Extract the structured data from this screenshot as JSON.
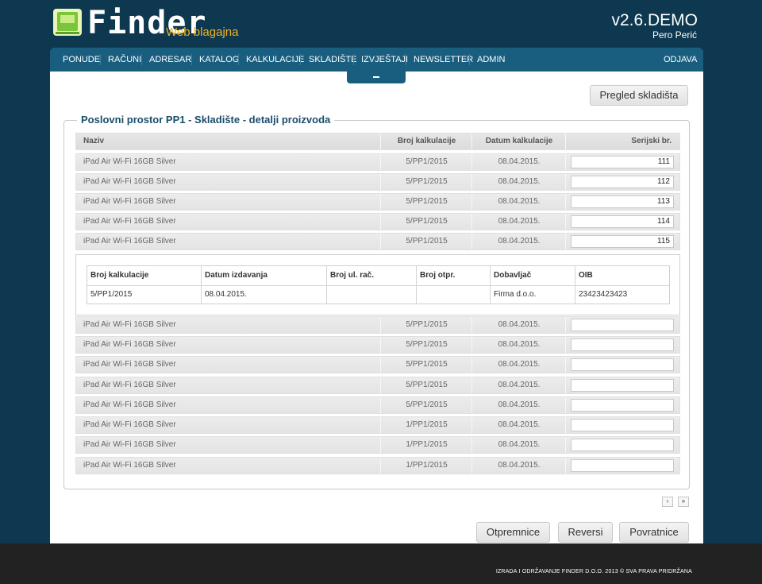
{
  "header": {
    "logo_text": "Finder",
    "logo_sub": "Web blagajna",
    "version": "v2.6.DEMO",
    "user": "Pero Perić"
  },
  "nav": {
    "items": [
      "PONUDE",
      "RAČUNI",
      "ADRESAR",
      "KATALOG",
      "KALKULACIJE",
      "SKLADIŠTE",
      "IZVJEŠTAJI",
      "NEWSLETTER",
      "ADMIN"
    ],
    "logout": "ODJAVA"
  },
  "toolbar": {
    "overview_button": "Pregled skladišta"
  },
  "panel": {
    "legend": "Poslovni prostor PP1 - Skladište - detalji proizvoda"
  },
  "table": {
    "columns": [
      "Naziv",
      "Broj kalkulacije",
      "Datum kalkulacije",
      "Serijski br."
    ],
    "rows": [
      {
        "name": "iPad Air Wi-Fi 16GB Silver",
        "broj": "5/PP1/2015",
        "datum": "08.04.2015.",
        "serial": "111"
      },
      {
        "name": "iPad Air Wi-Fi 16GB Silver",
        "broj": "5/PP1/2015",
        "datum": "08.04.2015.",
        "serial": "112"
      },
      {
        "name": "iPad Air Wi-Fi 16GB Silver",
        "broj": "5/PP1/2015",
        "datum": "08.04.2015.",
        "serial": "113"
      },
      {
        "name": "iPad Air Wi-Fi 16GB Silver",
        "broj": "5/PP1/2015",
        "datum": "08.04.2015.",
        "serial": "114"
      },
      {
        "name": "iPad Air Wi-Fi 16GB Silver",
        "broj": "5/PP1/2015",
        "datum": "08.04.2015.",
        "serial": "115"
      },
      {
        "name": "iPad Air Wi-Fi 16GB Silver",
        "broj": "5/PP1/2015",
        "datum": "08.04.2015.",
        "serial": ""
      },
      {
        "name": "iPad Air Wi-Fi 16GB Silver",
        "broj": "5/PP1/2015",
        "datum": "08.04.2015.",
        "serial": ""
      },
      {
        "name": "iPad Air Wi-Fi 16GB Silver",
        "broj": "5/PP1/2015",
        "datum": "08.04.2015.",
        "serial": ""
      },
      {
        "name": "iPad Air Wi-Fi 16GB Silver",
        "broj": "5/PP1/2015",
        "datum": "08.04.2015.",
        "serial": ""
      },
      {
        "name": "iPad Air Wi-Fi 16GB Silver",
        "broj": "5/PP1/2015",
        "datum": "08.04.2015.",
        "serial": ""
      },
      {
        "name": "iPad Air Wi-Fi 16GB Silver",
        "broj": "1/PP1/2015",
        "datum": "08.04.2015.",
        "serial": ""
      },
      {
        "name": "iPad Air Wi-Fi 16GB Silver",
        "broj": "1/PP1/2015",
        "datum": "08.04.2015.",
        "serial": ""
      },
      {
        "name": "iPad Air Wi-Fi 16GB Silver",
        "broj": "1/PP1/2015",
        "datum": "08.04.2015.",
        "serial": ""
      }
    ]
  },
  "detail": {
    "columns": [
      "Broj kalkulacije",
      "Datum izdavanja",
      "Broj ul. rač.",
      "Broj otpr.",
      "Dobavljač",
      "OIB"
    ],
    "values": [
      "5/PP1/2015",
      "08.04.2015.",
      "",
      "",
      "Firma d.o.o.",
      "23423423423"
    ]
  },
  "pager": {
    "next": "›",
    "last": "»"
  },
  "actions": {
    "otpremnice": "Otpremnice",
    "reversi": "Reversi",
    "povratnice": "Povratnice"
  },
  "footer": {
    "text": "IZRADA I ODRŽAVANJE FINDER D.O.O. 2013 © SVA PRAVA PRIDRŽANA"
  },
  "colors": {
    "background": "#0d3850",
    "nav": "#1a5e7f",
    "accent": "#f0b323",
    "title": "#1b4d6b"
  }
}
